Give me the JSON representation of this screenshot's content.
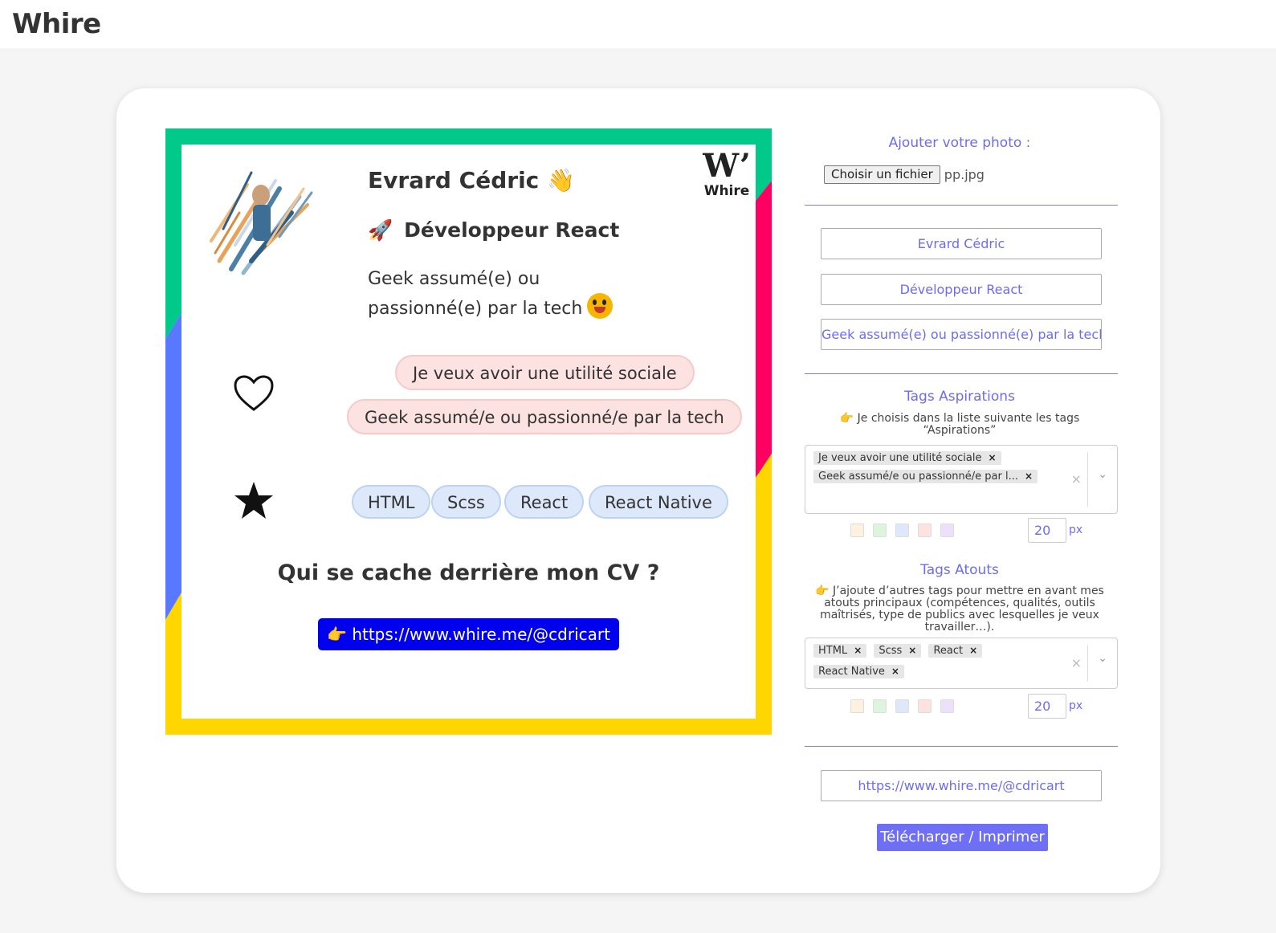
{
  "app": {
    "logo": "Whire"
  },
  "preview": {
    "brand": "Whire",
    "name": "Evrard Cédric",
    "name_emoji": "👋",
    "job_icon": "🚀",
    "job": "Développeur React",
    "desc": "Geek assumé(e) ou passionné(e) par la tech",
    "aspirations": [
      "Je veux avoir une utilité sociale",
      "Geek assumé/e ou passionné/e par la tech"
    ],
    "atouts": [
      "HTML",
      "Scss",
      "React",
      "React Native"
    ],
    "question": "Qui se cache derrière mon CV ?",
    "link_icon": "👉",
    "link": "https://www.whire.me/@cdricart"
  },
  "form": {
    "photo_label": "Ajouter votre photo :",
    "file_button": "Choisir un fichier",
    "file_name": "pp.jpg",
    "name_value": "Evrard Cédric",
    "job_value": "Développeur React",
    "desc_value": "Geek assumé(e) ou passionné(e) par la tech",
    "aspirations_title": "Tags Aspirations",
    "aspirations_hint_l1": "👉 Je choisis dans la liste suivante les tags",
    "aspirations_hint_l2": "“Aspirations”",
    "aspirations_chips": [
      "Je veux avoir une utilité sociale",
      "Geek assumé/e ou passionné/e par l..."
    ],
    "aspirations_size": "20",
    "atouts_title": "Tags Atouts",
    "atouts_hint_l1": "👉 J’ajoute d’autres tags pour mettre en avant mes",
    "atouts_hint_l2": "atouts principaux (compétences, qualités, outils",
    "atouts_hint_l3": "maîtrisés, type de publics avec lesquelles je veux",
    "atouts_hint_l4": "travailler…).",
    "atouts_chips": [
      "HTML",
      "Scss",
      "React",
      "React Native"
    ],
    "atouts_size": "20",
    "px_unit": "px",
    "chip_remove": "×",
    "clear_symbol": "×",
    "chevron_symbol": "⌄",
    "link_value": "https://www.whire.me/@cdricart",
    "download_button": "Télécharger / Imprimer"
  },
  "colors": {
    "accent": "#6c6cf0",
    "frame_green": "#00c98a",
    "frame_red": "#ff0062",
    "frame_yellow": "#ffd600",
    "frame_blue": "#5878ff",
    "link_bg": "#0000ee",
    "swatches": [
      "#fff1e0",
      "#ddf5dd",
      "#dde9fb",
      "#fde2e2",
      "#ece0fb"
    ]
  }
}
